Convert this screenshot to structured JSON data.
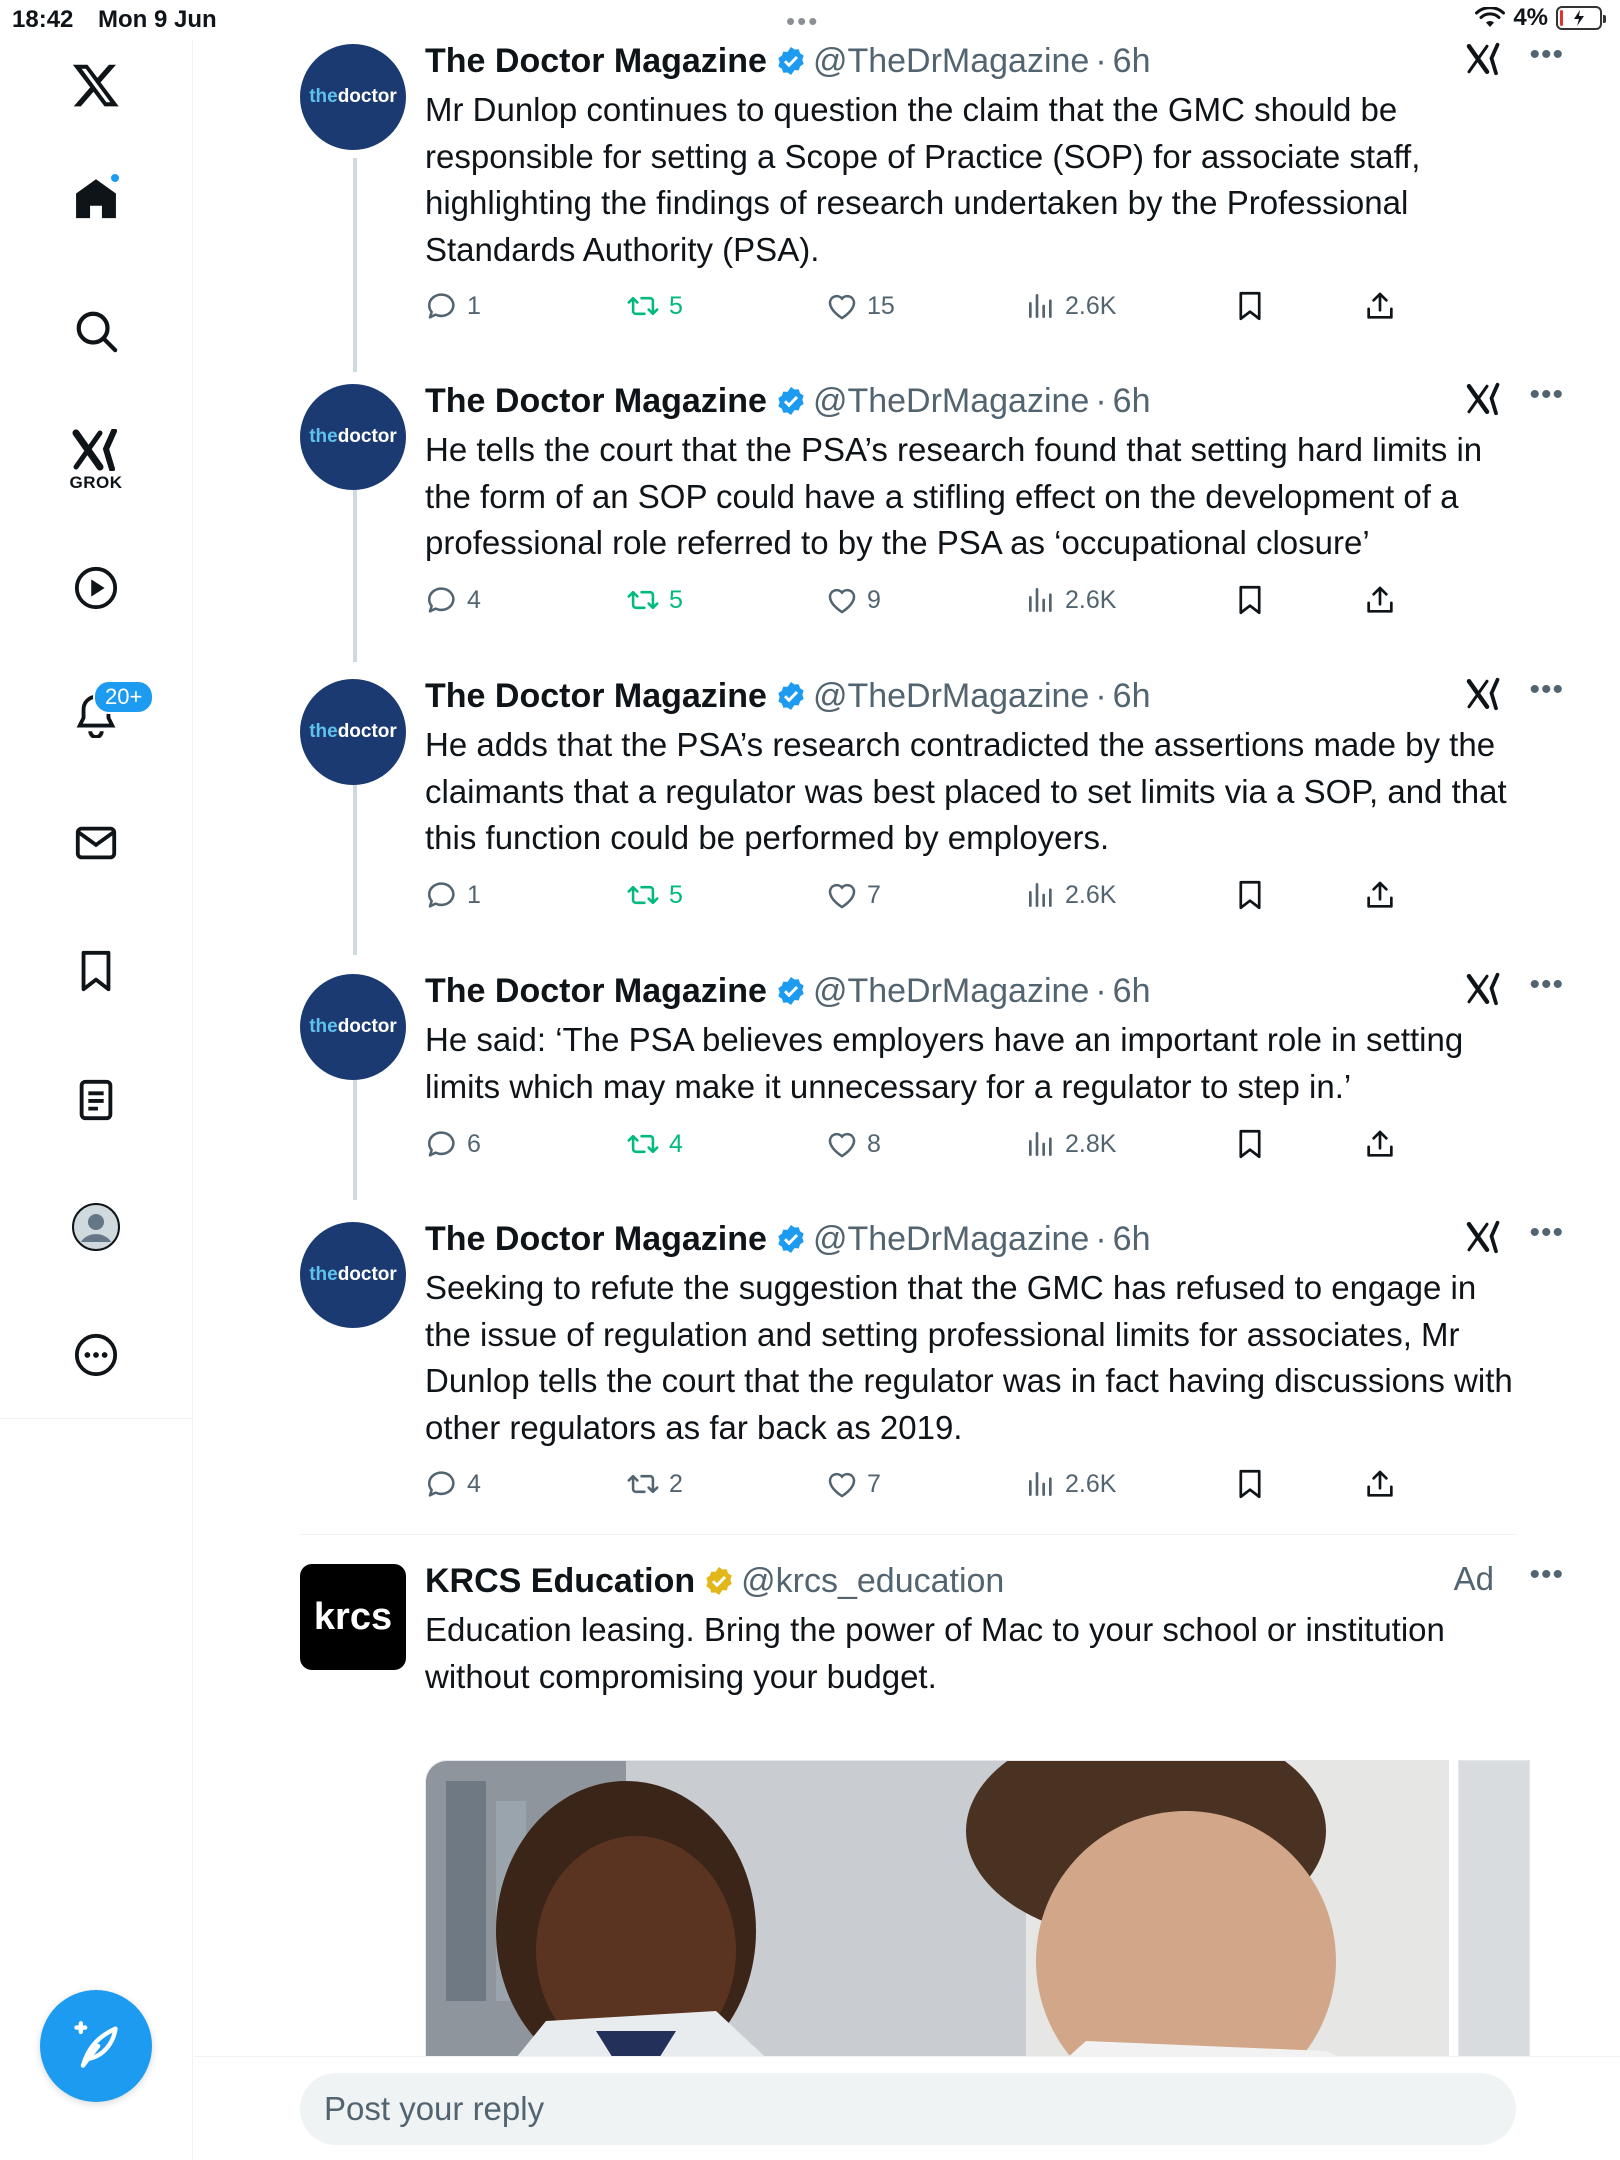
{
  "status_bar": {
    "time": "18:42",
    "date": "Mon 9 Jun",
    "battery": "4%"
  },
  "sidebar": {
    "grok_label": "GROK",
    "notifications_badge": "20+",
    "accent": "#1d9bf0"
  },
  "tweets": [
    {
      "avatar_text_a": "the",
      "avatar_text_b": "doctor",
      "name": "The Doctor Magazine",
      "handle": "@TheDrMagazine",
      "sep": "·",
      "time": "6h",
      "text": "Mr Dunlop continues to question the claim that the GMC should be responsible for setting a Scope of Practice (SOP) for associate staff, highlighting the findings of research undertaken by the Professional Standards Authority (PSA).",
      "replies": "1",
      "reposts": "5",
      "likes": "15",
      "views": "2.6K"
    },
    {
      "avatar_text_a": "the",
      "avatar_text_b": "doctor",
      "name": "The Doctor Magazine",
      "handle": "@TheDrMagazine",
      "sep": "·",
      "time": "6h",
      "text": "He tells the court that the PSA’s research found that setting hard limits in the form of an SOP could have a stifling effect on the development of a professional role referred to by the PSA as ‘occupational closure’",
      "replies": "4",
      "reposts": "5",
      "likes": "9",
      "views": "2.6K"
    },
    {
      "avatar_text_a": "the",
      "avatar_text_b": "doctor",
      "name": "The Doctor Magazine",
      "handle": "@TheDrMagazine",
      "sep": "·",
      "time": "6h",
      "text": "He adds that the PSA’s research contradicted the assertions made by the claimants that a regulator was best placed to set limits via a SOP, and that this function could be performed by employers.",
      "replies": "1",
      "reposts": "5",
      "likes": "7",
      "views": "2.6K"
    },
    {
      "avatar_text_a": "the",
      "avatar_text_b": "doctor",
      "name": "The Doctor Magazine",
      "handle": "@TheDrMagazine",
      "sep": "·",
      "time": "6h",
      "text": "He said: ‘The PSA believes employers have an important role in setting limits which may make it unnecessary for a regulator to step in.’",
      "replies": "6",
      "reposts": "4",
      "likes": "8",
      "views": "2.8K"
    },
    {
      "avatar_text_a": "the",
      "avatar_text_b": "doctor",
      "name": "The Doctor Magazine",
      "handle": "@TheDrMagazine",
      "sep": "·",
      "time": "6h",
      "text": "Seeking to refute the suggestion that the GMC has refused to engage in the issue of regulation and setting professional limits for associates, Mr Dunlop tells the court that the regulator was in fact having discussions with other regulators as far back as 2019.",
      "replies": "4",
      "reposts": "2",
      "likes": "7",
      "views": "2.6K"
    }
  ],
  "ad": {
    "avatar_text": "krcs",
    "name": "KRCS Education",
    "handle": "@krcs_education",
    "label": "Ad",
    "text": "Education leasing. Bring the power of Mac to your school or institution without compromising your budget."
  },
  "reply": {
    "placeholder": "Post your reply"
  }
}
